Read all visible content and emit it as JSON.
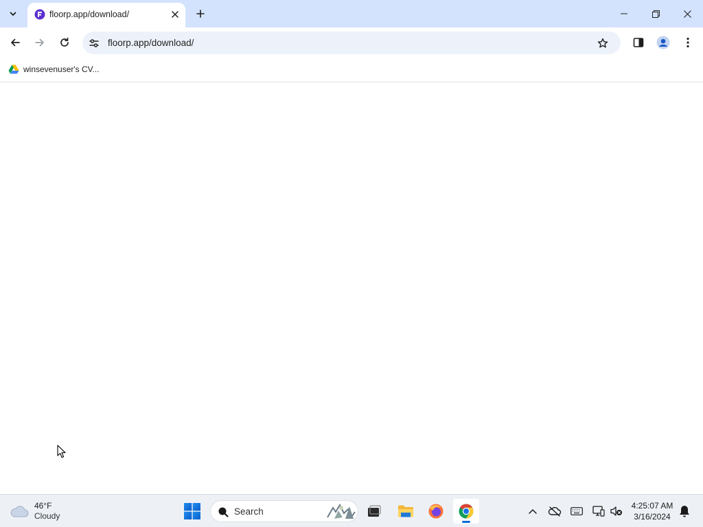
{
  "browser": {
    "tab": {
      "title": "floorp.app/download/"
    },
    "address_bar": {
      "url": "floorp.app/download/"
    },
    "bookmarks": [
      {
        "label": "winsevenuser's CV..."
      }
    ]
  },
  "taskbar": {
    "weather": {
      "temperature": "46°F",
      "condition": "Cloudy"
    },
    "search": {
      "placeholder": "Search"
    },
    "clock": {
      "time": "4:25:07 AM",
      "date": "3/16/2024"
    },
    "pinned_apps": [
      "windows-start",
      "task-view",
      "file-explorer",
      "firefox",
      "chrome"
    ]
  },
  "colors": {
    "tabstrip_bg": "#d3e3fd",
    "omnibox_bg": "#edf2fa",
    "taskbar_bg": "#edf1f6",
    "accent": "#0a6cd6"
  }
}
